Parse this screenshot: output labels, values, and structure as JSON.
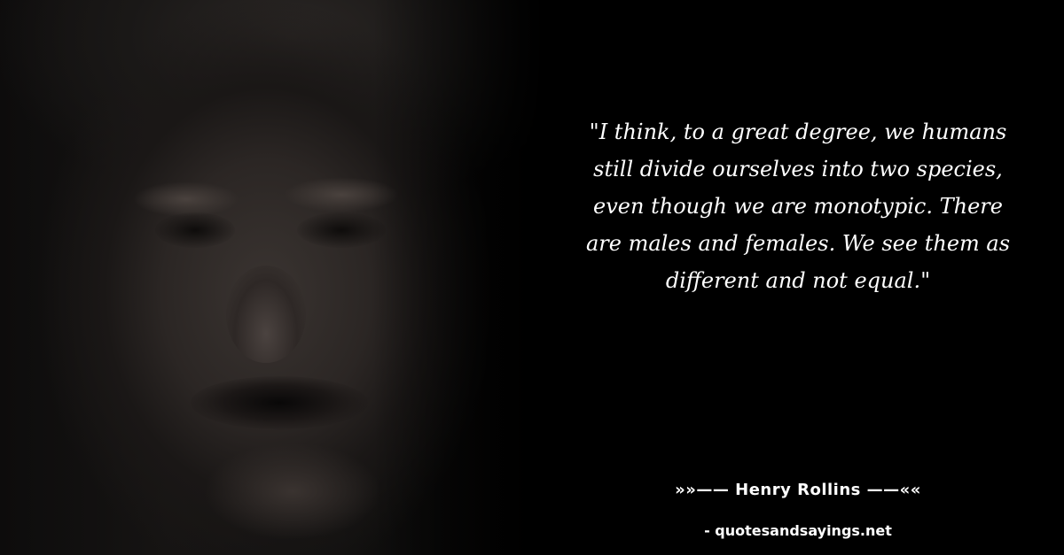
{
  "quote": {
    "text": "\"I think, to a great degree, we humans still divide ourselves into two species, even though we are monotypic. There are males and females. We see them as different and not equal.\""
  },
  "author": {
    "line": "»»—— Henry Rollins ——««"
  },
  "source": {
    "line": "- quotesandsayings.net"
  },
  "colors": {
    "background": "#000000",
    "text": "#ffffff"
  }
}
